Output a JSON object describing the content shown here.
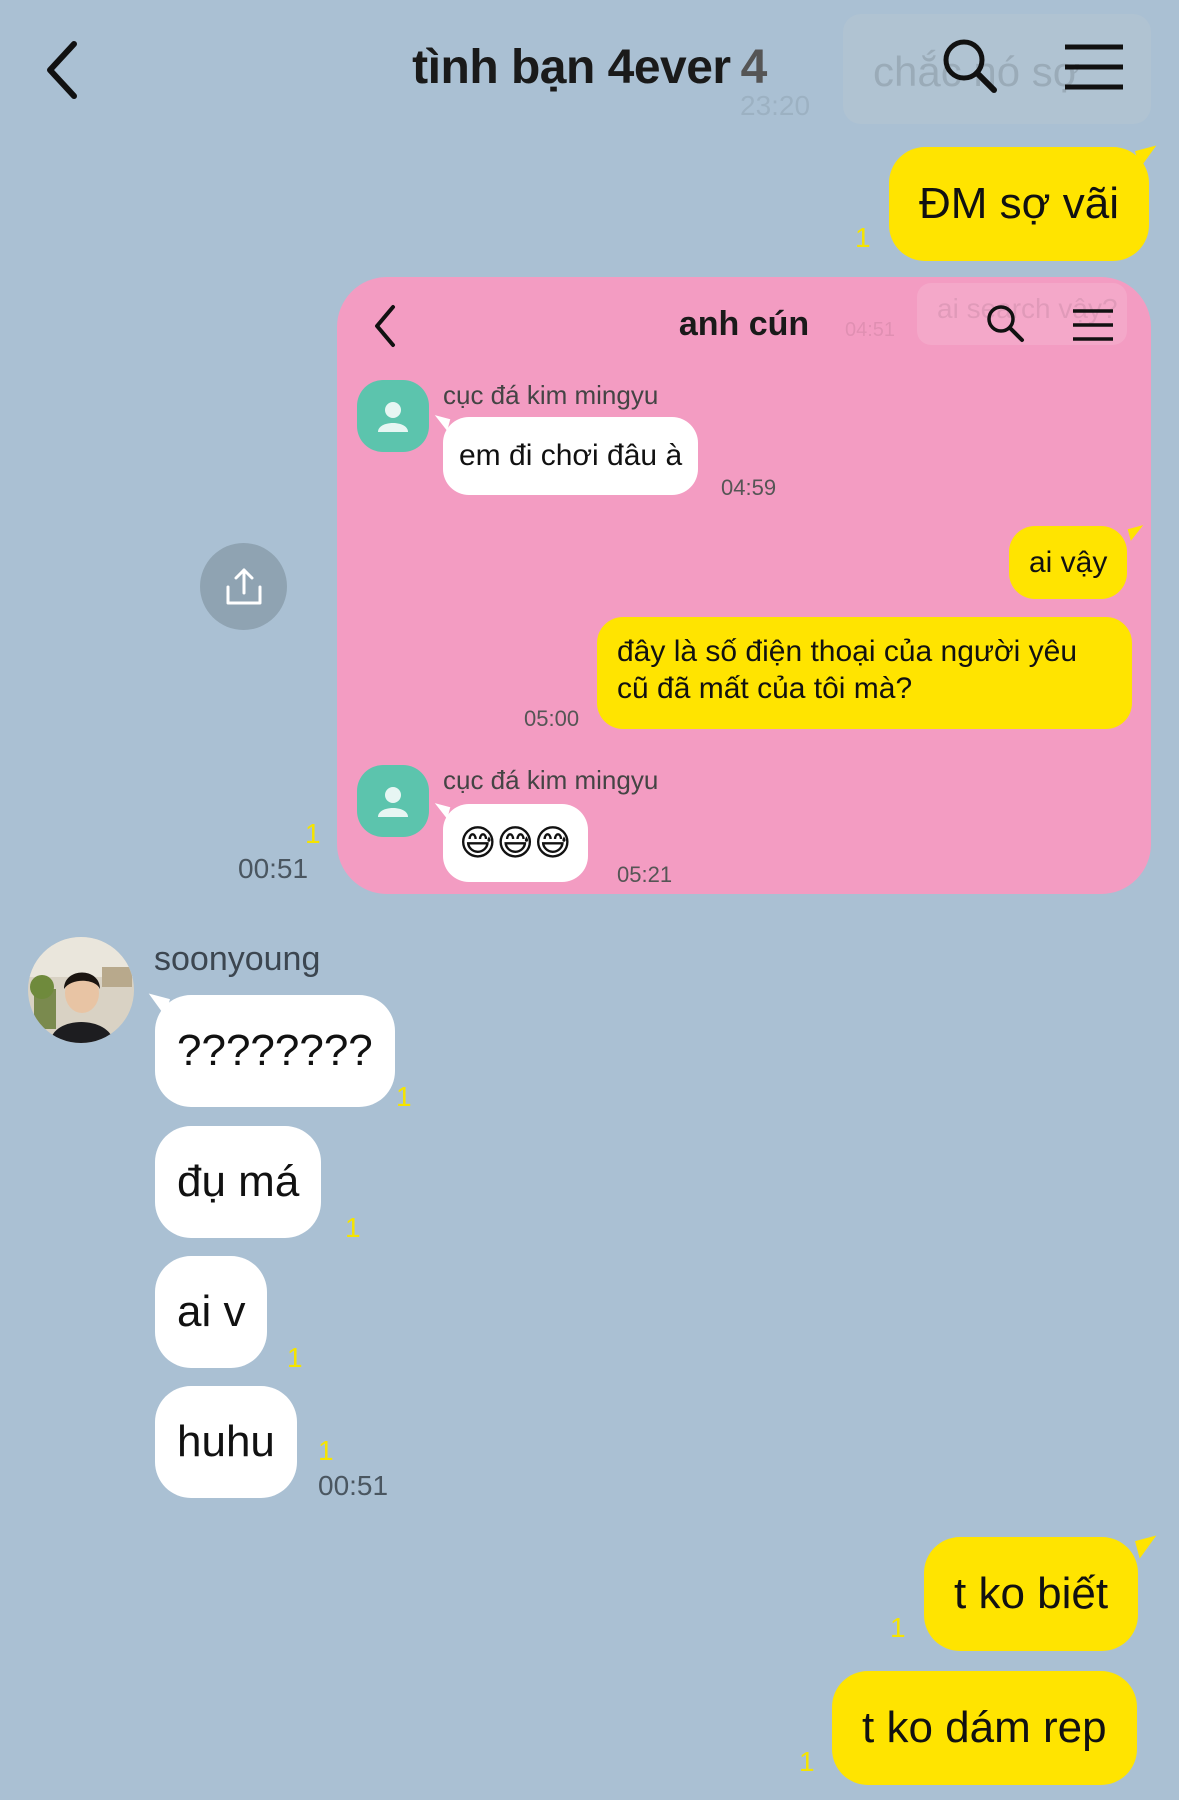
{
  "header": {
    "title": "tình bạn 4ever",
    "member_count": "4",
    "ghost_text": "chắc nó sợ",
    "ghost_time": "23:20"
  },
  "messages": {
    "m1_text": "ĐM sợ vãi",
    "m1_unread": "1",
    "shared_unread": "1",
    "shared_time": "00:51",
    "sender_name": "soonyoung",
    "r1_text": "????????",
    "r1_unread": "1",
    "r2_text": "đụ má",
    "r2_unread": "1",
    "r3_text": "ai v",
    "r3_unread": "1",
    "r4_text": "huhu",
    "r4_unread": "1",
    "r4_time": "00:51",
    "m2_text": "t ko biết",
    "m2_unread": "1",
    "m3_text": "t ko dám rep",
    "m3_unread": "1"
  },
  "shared_screenshot": {
    "title": "anh cún",
    "ghost_text": "ai search vậy?",
    "ghost_time": "04:51",
    "sender_1": "cục đá kim mingyu",
    "msg_1": "em đi chơi đâu à",
    "time_1": "04:59",
    "msg_2": "ai vậy",
    "msg_3": "đây là số điện thoại của người yêu cũ đã mất của tôi mà?",
    "time_3": "05:00",
    "sender_2": "cục đá kim mingyu",
    "msg_4": "😅😅😅",
    "time_4": "05:21"
  },
  "colors": {
    "background": "#aac0d3",
    "my_bubble": "#ffe400",
    "their_bubble": "#ffffff",
    "card": "#f39cc2",
    "avatar_default": "#5cc4ad"
  },
  "icons": [
    "back-icon",
    "search-icon",
    "menu-icon",
    "share-icon",
    "person-icon"
  ]
}
